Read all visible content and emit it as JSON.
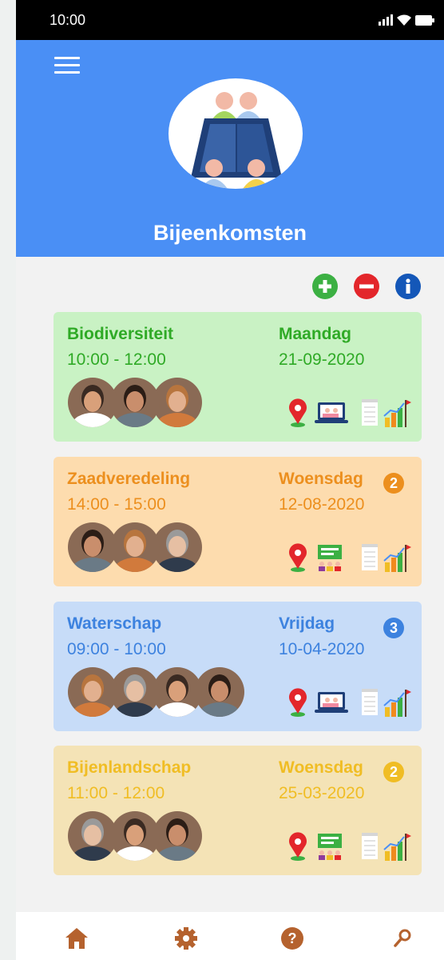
{
  "status": {
    "time": "10:00",
    "icons": [
      "signal-icon",
      "wifi-icon",
      "battery-icon"
    ]
  },
  "header": {
    "title": "Bijeenkomsten",
    "menu_icon": "menu-icon",
    "logo_icon": "meeting-logo-icon",
    "color": "#4a8ff5"
  },
  "actions": [
    {
      "name": "add-meeting-button",
      "icon": "plus-circle-icon",
      "color": "#3cb043"
    },
    {
      "name": "remove-meeting-button",
      "icon": "minus-circle-icon",
      "color": "#e3262b"
    },
    {
      "name": "info-button",
      "icon": "info-circle-icon",
      "color": "#1457b8"
    }
  ],
  "meetings": [
    {
      "title": "Biodiversiteit",
      "time": "10:00 - 12:00",
      "day": "Maandag",
      "date": "21-09-2020",
      "badge": null,
      "bg": "#c9f2c4",
      "fg": "#2faa26",
      "participants": 3,
      "tools": [
        "location-pin-icon",
        "laptop-video-icon",
        "notes-icon",
        "chart-flag-icon"
      ]
    },
    {
      "title": "Zaadveredeling",
      "time": "14:00 - 15:00",
      "day": "Woensdag",
      "date": "12-08-2020",
      "badge": "2",
      "bg": "#fddcae",
      "fg": "#ec8f1e",
      "participants": 3,
      "tools": [
        "location-pin-icon",
        "presentation-board-icon",
        "notes-icon",
        "chart-flag-icon"
      ]
    },
    {
      "title": "Waterschap",
      "time": "09:00 - 10:00",
      "day": "Vrijdag",
      "date": "10-04-2020",
      "badge": "3",
      "bg": "#c7dcf8",
      "fg": "#3d82df",
      "participants": 4,
      "tools": [
        "location-pin-icon",
        "laptop-video-icon",
        "notes-icon",
        "chart-flag-icon"
      ]
    },
    {
      "title": "Bijenlandschap",
      "time": "11:00 - 12:00",
      "day": "Woensdag",
      "date": "25-03-2020",
      "badge": "2",
      "bg": "#f4e3b6",
      "fg": "#f0bd24",
      "participants": 3,
      "tools": [
        "location-pin-icon",
        "presentation-board-icon",
        "notes-icon",
        "chart-flag-icon"
      ]
    }
  ],
  "nav": [
    {
      "name": "nav-home",
      "icon": "home-icon",
      "color": "#b5622e"
    },
    {
      "name": "nav-settings",
      "icon": "gear-icon",
      "color": "#b5622e"
    },
    {
      "name": "nav-help",
      "icon": "help-icon",
      "color": "#b5622e"
    },
    {
      "name": "nav-search",
      "icon": "search-icon",
      "color": "#b5622e"
    }
  ]
}
